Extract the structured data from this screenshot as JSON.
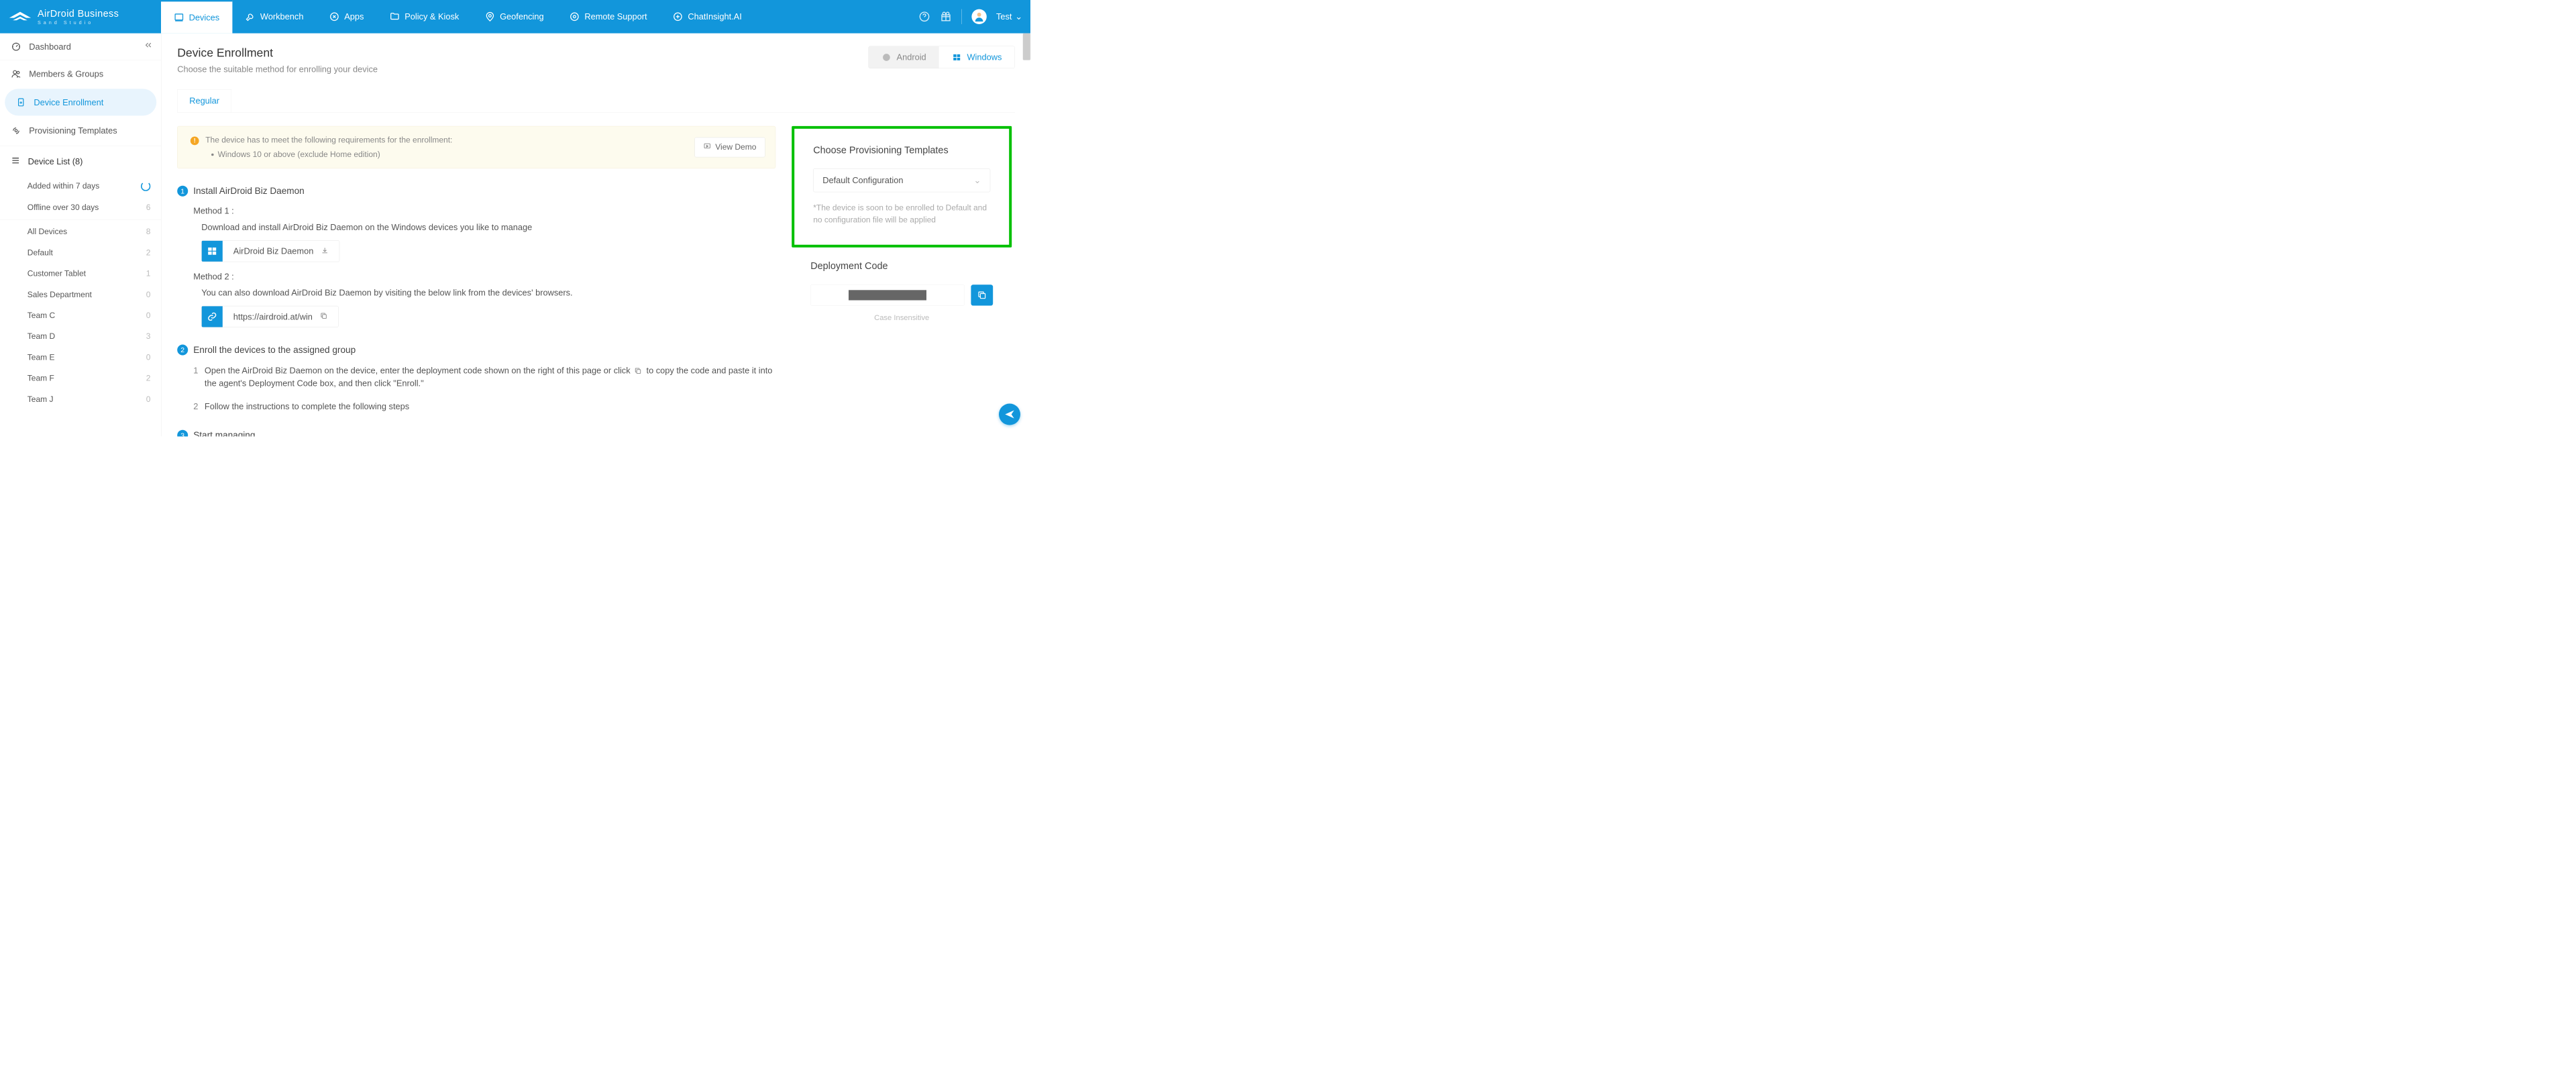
{
  "brand": {
    "name": "AirDroid Business",
    "sub": "Sand Studio"
  },
  "nav": [
    {
      "label": "Devices",
      "icon": "devices"
    },
    {
      "label": "Workbench",
      "icon": "wrench"
    },
    {
      "label": "Apps",
      "icon": "apps"
    },
    {
      "label": "Policy & Kiosk",
      "icon": "folder"
    },
    {
      "label": "Geofencing",
      "icon": "geo"
    },
    {
      "label": "Remote Support",
      "icon": "support"
    },
    {
      "label": "ChatInsight.AI",
      "icon": "chat"
    }
  ],
  "user": {
    "name": "Test"
  },
  "sidebar": {
    "dashboard": "Dashboard",
    "members": "Members & Groups",
    "enrollment": "Device Enrollment",
    "provisioning": "Provisioning Templates",
    "device_list_label": "Device List (8)",
    "items": [
      {
        "label": "Added within 7 days",
        "count": ""
      },
      {
        "label": "Offline over 30 days",
        "count": "6"
      },
      {
        "label": "All Devices",
        "count": "8"
      },
      {
        "label": "Default",
        "count": "2"
      },
      {
        "label": "Customer Tablet",
        "count": "1"
      },
      {
        "label": "Sales Department",
        "count": "0"
      },
      {
        "label": "Team C",
        "count": "0"
      },
      {
        "label": "Team D",
        "count": "3"
      },
      {
        "label": "Team E",
        "count": "0"
      },
      {
        "label": "Team F",
        "count": "2"
      },
      {
        "label": "Team J",
        "count": "0"
      }
    ]
  },
  "page": {
    "title": "Device Enrollment",
    "subtitle": "Choose the suitable method for enrolling your device",
    "os": {
      "android": "Android",
      "windows": "Windows"
    },
    "tab": "Regular",
    "notice": {
      "text": "The device has to meet the following requirements for the enrollment:",
      "req": "Windows 10 or above (exclude Home edition)",
      "view_demo": "View Demo"
    },
    "step1": {
      "title": "Install AirDroid Biz Daemon",
      "m1": "Method 1 :",
      "m1_desc": "Download and install AirDroid Biz Daemon on the Windows devices you like to manage",
      "dl_label": "AirDroid Biz Daemon",
      "m2": "Method 2 :",
      "m2_desc": "You can also download AirDroid Biz Daemon by visiting the below link from the devices' browsers.",
      "link": "https://airdroid.at/win"
    },
    "step2": {
      "title": "Enroll the devices to the assigned group",
      "i1a": "Open the AirDroid Biz Daemon on the device, enter the deployment code shown on the right of this page or click ",
      "i1b": " to copy the code and paste it into the agent's Deployment Code box, and then click \"Enroll.\"",
      "i2": "Follow the instructions to complete the following steps"
    },
    "step3": {
      "title": "Start managing"
    }
  },
  "right": {
    "prov_title": "Choose Provisioning Templates",
    "select_value": "Default Configuration",
    "prov_note": "*The device is soon to be enrolled to Default and no configuration file will be applied",
    "deploy_title": "Deployment Code",
    "case": "Case Insensitive"
  }
}
